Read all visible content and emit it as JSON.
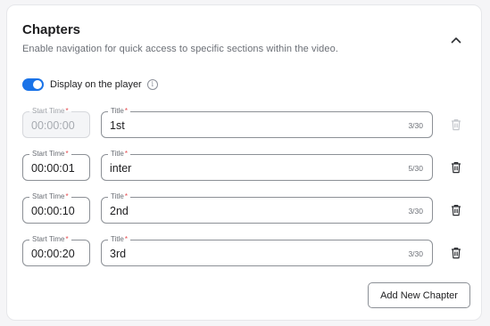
{
  "section": {
    "title": "Chapters",
    "subtitle": "Enable navigation for quick access to specific sections within the video."
  },
  "display_toggle": {
    "label": "Display on the player",
    "enabled": true,
    "info_glyph": "i"
  },
  "labels": {
    "start_time": "Start Time",
    "title": "Title",
    "required_marker": "*"
  },
  "chapters": [
    {
      "start_time": "00:00:00",
      "title": "1st",
      "count": "3/30",
      "start_disabled": true,
      "delete_disabled": true
    },
    {
      "start_time": "00:00:01",
      "title": "inter",
      "count": "5/30",
      "start_disabled": false,
      "delete_disabled": false
    },
    {
      "start_time": "00:00:10",
      "title": "2nd",
      "count": "3/30",
      "start_disabled": false,
      "delete_disabled": false
    },
    {
      "start_time": "00:00:20",
      "title": "3rd",
      "count": "3/30",
      "start_disabled": false,
      "delete_disabled": false
    }
  ],
  "add_button": {
    "label": "Add New Chapter"
  },
  "icons": {
    "collapse": "chevron-up-icon",
    "info": "info-icon",
    "delete": "trash-icon"
  },
  "colors": {
    "accent": "#1a73e8",
    "required": "#e5484d",
    "disabled_icon": "#c4c7cc",
    "icon": "#2b2d31"
  }
}
